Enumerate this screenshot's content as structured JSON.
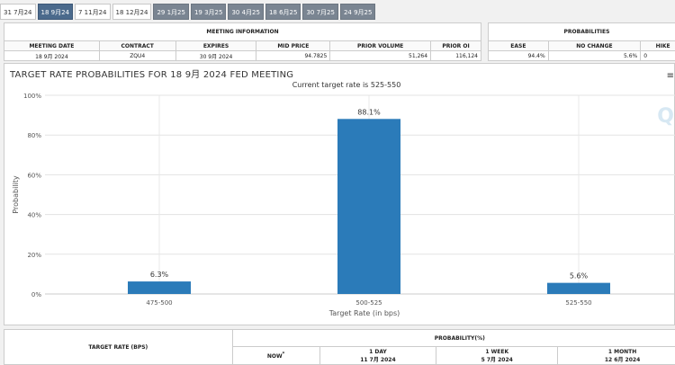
{
  "tabs": [
    {
      "label": "31 7月24",
      "state": "light"
    },
    {
      "label": "18 9月24",
      "state": "active"
    },
    {
      "label": "7 11月24",
      "state": "light"
    },
    {
      "label": "18 12月24",
      "state": "light"
    },
    {
      "label": "29 1月25",
      "state": "dark"
    },
    {
      "label": "19 3月25",
      "state": "dark"
    },
    {
      "label": "30 4月25",
      "state": "dark"
    },
    {
      "label": "18 6月25",
      "state": "dark"
    },
    {
      "label": "30 7月25",
      "state": "dark"
    },
    {
      "label": "24 9月25",
      "state": "dark"
    }
  ],
  "meeting_info": {
    "title": "MEETING INFORMATION",
    "headers": [
      "MEETING DATE",
      "CONTRACT",
      "EXPIRES",
      "MID PRICE",
      "PRIOR VOLUME",
      "PRIOR OI"
    ],
    "values": [
      "18 9月 2024",
      "ZQU4",
      "30 9月 2024",
      "94.7825",
      "51,264",
      "116,124"
    ]
  },
  "probabilities": {
    "title": "PROBABILITIES",
    "headers": [
      "EASE",
      "NO CHANGE",
      "HIKE"
    ],
    "values": [
      "94.4%",
      "5.6%",
      "0"
    ]
  },
  "chart_header": {
    "title": "TARGET RATE PROBABILITIES FOR 18 9月 2024 FED MEETING",
    "subtitle": "Current target rate is 525-550",
    "watermark": "Q",
    "menu_icon": "hamburger-menu-icon"
  },
  "chart_data": {
    "type": "bar",
    "title": "TARGET RATE PROBABILITIES FOR 18 9月 2024 FED MEETING",
    "subtitle": "Current target rate is 525-550",
    "categories": [
      "475-500",
      "500-525",
      "525-550"
    ],
    "values": [
      6.3,
      88.1,
      5.6
    ],
    "data_labels": [
      "6.3%",
      "88.1%",
      "5.6%"
    ],
    "xlabel": "Target Rate (in bps)",
    "ylabel": "Probability",
    "ylim": [
      0,
      100
    ],
    "yticks": [
      "0%",
      "20%",
      "40%",
      "60%",
      "80%",
      "100%"
    ],
    "grid": true,
    "bar_color": "#2b7bb9"
  },
  "bottom_table": {
    "target_rate_header": "TARGET RATE (BPS)",
    "probability_header": "PROBABILITY(%)",
    "columns": [
      {
        "label": "NOW",
        "sup": "*",
        "date": ""
      },
      {
        "label": "1 DAY",
        "sup": "",
        "date": "11 7月 2024"
      },
      {
        "label": "1 WEEK",
        "sup": "",
        "date": "5 7月 2024"
      },
      {
        "label": "1 MONTH",
        "sup": "",
        "date": "12 6月 2024"
      }
    ]
  }
}
